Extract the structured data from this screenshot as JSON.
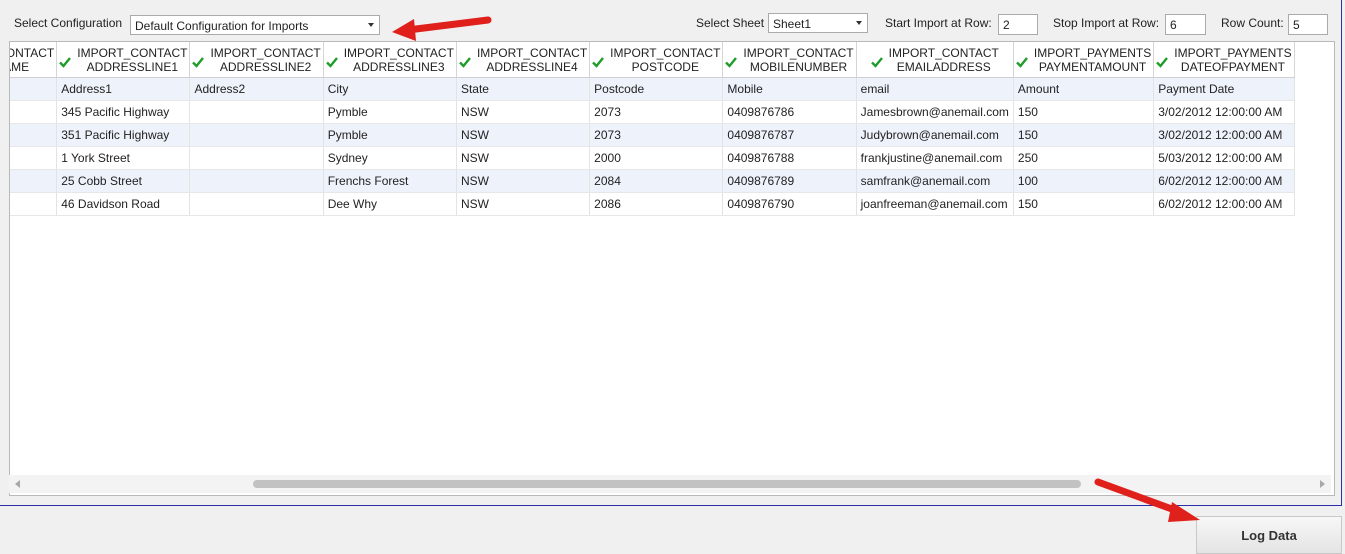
{
  "toolbar": {
    "select_configuration_label": "Select Configuration",
    "configuration_value": "Default Configuration for Imports",
    "select_sheet_label": "Select Sheet",
    "sheet_value": "Sheet1",
    "start_row_label": "Start Import at Row:",
    "start_row_value": "2",
    "stop_row_label": "Stop Import at Row:",
    "stop_row_value": "6",
    "row_count_label": "Row Count:",
    "row_count_value": "5"
  },
  "grid": {
    "columns": [
      {
        "line1": "IMPORT_CONTACT",
        "line2": "SURNAME",
        "checked": true
      },
      {
        "line1": "IMPORT_CONTACT",
        "line2": "ADDRESSLINE1",
        "checked": true
      },
      {
        "line1": "IMPORT_CONTACT",
        "line2": "ADDRESSLINE2",
        "checked": true
      },
      {
        "line1": "IMPORT_CONTACT",
        "line2": "ADDRESSLINE3",
        "checked": true
      },
      {
        "line1": "IMPORT_CONTACT",
        "line2": "ADDRESSLINE4",
        "checked": true
      },
      {
        "line1": "IMPORT_CONTACT",
        "line2": "POSTCODE",
        "checked": true
      },
      {
        "line1": "IMPORT_CONTACT",
        "line2": "MOBILENUMBER",
        "checked": true
      },
      {
        "line1": "IMPORT_CONTACT",
        "line2": "EMAILADDRESS",
        "checked": true
      },
      {
        "line1": "IMPORT_PAYMENTS",
        "line2": "PAYMENTAMOUNT",
        "checked": true
      },
      {
        "line1": "IMPORT_PAYMENTS",
        "line2": "DATEOFPAYMENT",
        "checked": true
      }
    ],
    "rows": [
      [
        "",
        "Address1",
        "Address2",
        "City",
        "State",
        "Postcode",
        "Mobile",
        "email",
        "Amount",
        "Payment Date"
      ],
      [
        "",
        "345 Pacific Highway",
        "",
        "Pymble",
        "NSW",
        "2073",
        "0409876786",
        "Jamesbrown@anemail.com",
        "150",
        "3/02/2012 12:00:00 AM"
      ],
      [
        "",
        "351 Pacific Highway",
        "",
        "Pymble",
        "NSW",
        "2073",
        "0409876787",
        "Judybrown@anemail.com",
        "150",
        "3/02/2012 12:00:00 AM"
      ],
      [
        "",
        "1 York Street",
        "",
        "Sydney",
        "NSW",
        "2000",
        "0409876788",
        "frankjustine@anemail.com",
        "250",
        "5/03/2012 12:00:00 AM"
      ],
      [
        "",
        "25 Cobb Street",
        "",
        "Frenchs Forest",
        "NSW",
        "2084",
        "0409876789",
        "samfrank@anemail.com",
        "100",
        "6/02/2012 12:00:00 AM"
      ],
      [
        "",
        "46 Davidson Road",
        "",
        "Dee Why",
        "NSW",
        "2086",
        "0409876790",
        "joanfreeman@anemail.com",
        "150",
        "6/02/2012 12:00:00 AM"
      ]
    ]
  },
  "footer": {
    "log_data_label": "Log Data"
  },
  "colors": {
    "check_green": "#1f9d2a",
    "annotation_red": "#e0201b",
    "frame_border": "#2b2fa8"
  },
  "icons": {
    "column_checked": "checkmark-icon",
    "dropdown": "chevron-down-icon"
  }
}
